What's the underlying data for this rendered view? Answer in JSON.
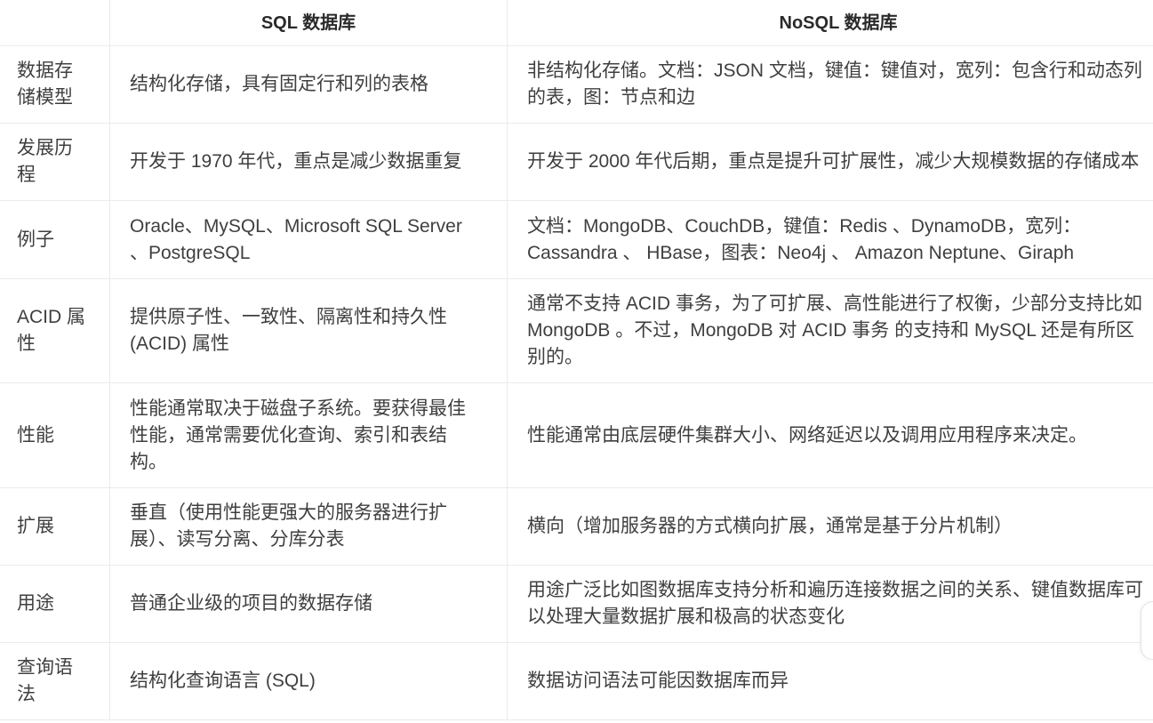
{
  "table": {
    "headers": {
      "sql": "SQL 数据库",
      "nosql": "NoSQL 数据库"
    },
    "rows": [
      {
        "aspect": "数据存储模型",
        "sql": "结构化存储，具有固定行和列的表格",
        "nosql": "非结构化存储。文档：JSON 文档，键值：键值对，宽列：包含行和动态列的表，图：节点和边"
      },
      {
        "aspect": "发展历程",
        "sql": "开发于 1970 年代，重点是减少数据重复",
        "nosql": "开发于 2000 年代后期，重点是提升可扩展性，减少大规模数据的存储成本"
      },
      {
        "aspect": "例子",
        "sql": "Oracle、MySQL、Microsoft SQL Server 、PostgreSQL",
        "nosql": "文档：MongoDB、CouchDB，键值：Redis 、DynamoDB，宽列：Cassandra 、 HBase，图表：Neo4j 、 Amazon Neptune、Giraph"
      },
      {
        "aspect": "ACID 属性",
        "sql": "提供原子性、一致性、隔离性和持久性 (ACID) 属性",
        "nosql": "通常不支持 ACID 事务，为了可扩展、高性能进行了权衡，少部分支持比如 MongoDB 。不过，MongoDB 对 ACID 事务 的支持和 MySQL 还是有所区别的。"
      },
      {
        "aspect": "性能",
        "sql": "性能通常取决于磁盘子系统。要获得最佳性能，通常需要优化查询、索引和表结构。",
        "nosql": "性能通常由底层硬件集群大小、网络延迟以及调用应用程序来决定。"
      },
      {
        "aspect": "扩展",
        "sql": "垂直（使用性能更强大的服务器进行扩展）、读写分离、分库分表",
        "nosql": "横向（增加服务器的方式横向扩展，通常是基于分片机制）"
      },
      {
        "aspect": "用途",
        "sql": "普通企业级的项目的数据存储",
        "nosql": "用途广泛比如图数据库支持分析和遍历连接数据之间的关系、键值数据库可以处理大量数据扩展和极高的状态变化"
      },
      {
        "aspect": "查询语法",
        "sql": "结构化查询语言 (SQL)",
        "nosql": "数据访问语法可能因数据库而异"
      }
    ]
  },
  "colors": {
    "background": "#ffffff",
    "text": "#3f3f3f",
    "header_text": "#2a2a2a",
    "border": "#ebebeb"
  }
}
